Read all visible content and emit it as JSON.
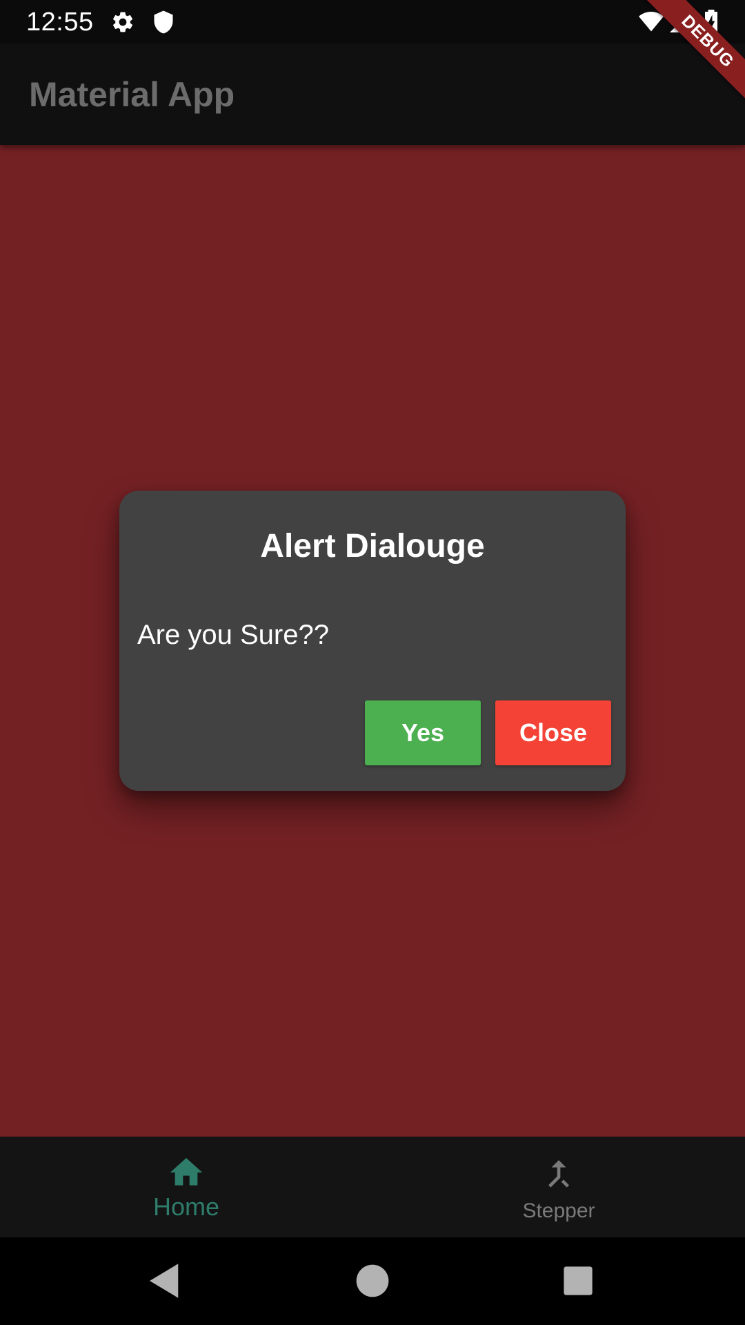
{
  "status_bar": {
    "time": "12:55",
    "icons": [
      "gear-icon",
      "shield-icon",
      "wifi-icon",
      "signal-icon",
      "battery-charging-icon"
    ]
  },
  "debug_banner": {
    "label": "DEBUG"
  },
  "app_bar": {
    "title": "Material App"
  },
  "body": {
    "background_color": "#742124"
  },
  "dialog": {
    "title": "Alert Dialouge",
    "message": "Are you Sure??",
    "yes_label": "Yes",
    "close_label": "Close",
    "yes_color": "#4caf50",
    "close_color": "#f44336"
  },
  "bottom_nav": {
    "items": [
      {
        "label": "Home",
        "icon": "home-icon",
        "selected": true
      },
      {
        "label": "Stepper",
        "icon": "merge-icon",
        "selected": false
      }
    ],
    "active_color": "#2e7d6b"
  },
  "system_nav": {
    "icons": [
      "back-icon",
      "home-circle-icon",
      "recents-icon"
    ]
  }
}
